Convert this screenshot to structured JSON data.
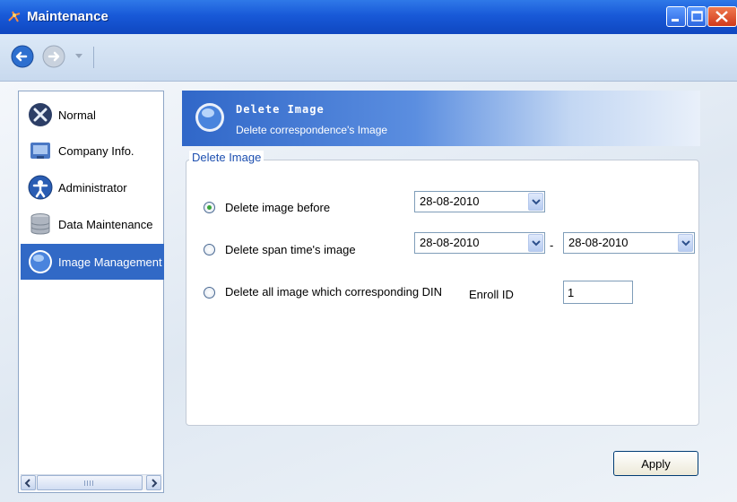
{
  "window": {
    "title": "Maintenance"
  },
  "toolbar": {
    "back_icon": "back-arrow-icon",
    "forward_icon": "forward-arrow-icon"
  },
  "sidebar": {
    "items": [
      {
        "label": "Normal",
        "icon": "wrench-screwdriver-icon"
      },
      {
        "label": "Company Info.",
        "icon": "company-icon"
      },
      {
        "label": "Administrator",
        "icon": "administrator-icon"
      },
      {
        "label": "Data Maintenance",
        "icon": "database-icon"
      },
      {
        "label": "Image Management",
        "icon": "image-management-icon",
        "selected": true
      }
    ]
  },
  "header": {
    "title": "Delete Image",
    "subtitle": "Delete correspondence's Image"
  },
  "group": {
    "legend": "Delete Image",
    "options": [
      {
        "label": "Delete image before",
        "selected": true,
        "date": "28-08-2010"
      },
      {
        "label": "Delete span time's image",
        "selected": false,
        "date_from": "28-08-2010",
        "separator": "-",
        "date_to": "28-08-2010"
      },
      {
        "label": "Delete all image which corresponding DIN",
        "selected": false,
        "enroll_label": "Enroll ID",
        "enroll_value": "1"
      }
    ]
  },
  "footer": {
    "apply_label": "Apply"
  },
  "colors": {
    "titlebar": "#1859d8",
    "selection": "#3169c6",
    "legend": "#1d4fb0"
  }
}
